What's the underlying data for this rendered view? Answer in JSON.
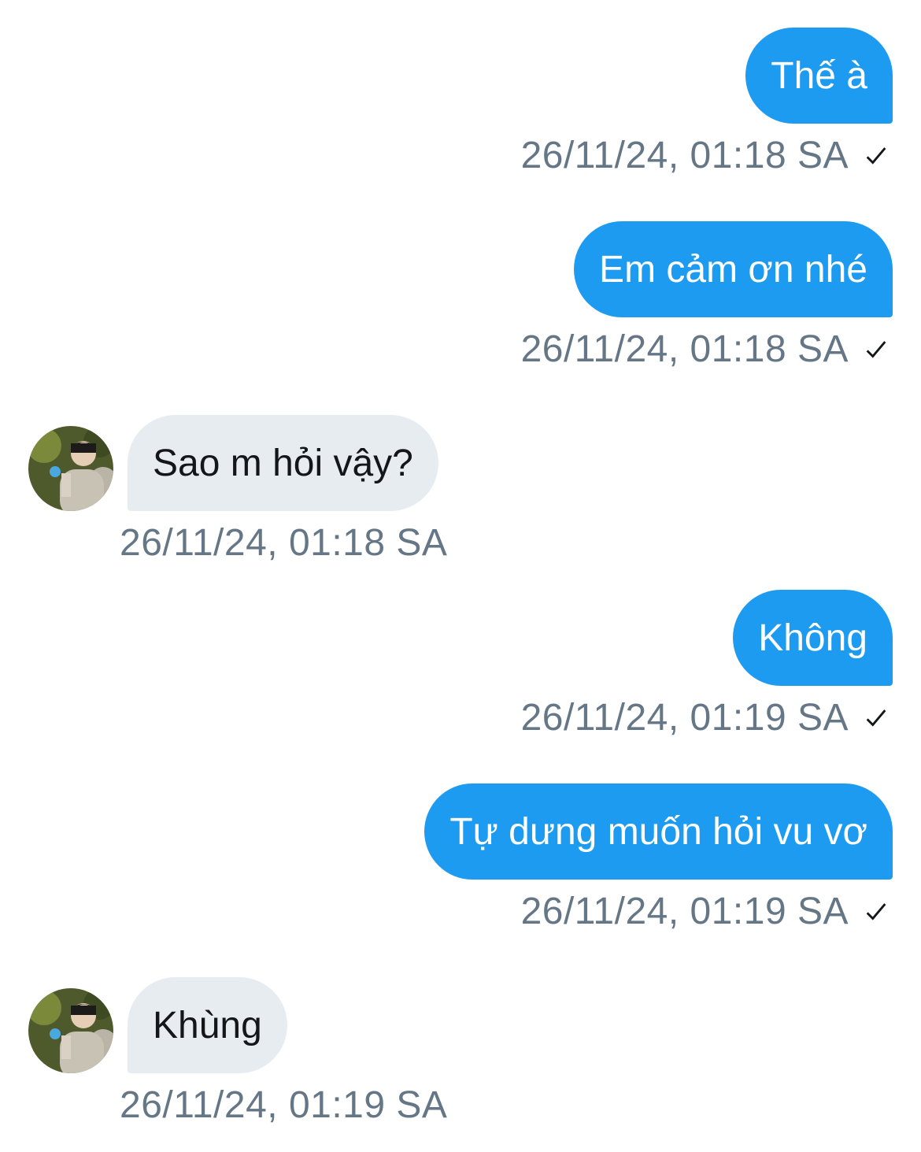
{
  "messages": [
    {
      "direction": "out",
      "text": "Thế à",
      "time": "26/11/24, 01:18 SA",
      "status_icon": "check-icon"
    },
    {
      "direction": "out",
      "text": "Em cảm ơn nhé",
      "time": "26/11/24, 01:18 SA",
      "status_icon": "check-icon"
    },
    {
      "direction": "in",
      "text": "Sao m hỏi vậy?",
      "time": "26/11/24, 01:18 SA",
      "avatar_icon": "avatar-photo"
    },
    {
      "direction": "out",
      "text": "Không",
      "time": "26/11/24, 01:19 SA",
      "status_icon": "check-icon"
    },
    {
      "direction": "out",
      "text": "Tự dưng muốn hỏi vu vơ",
      "time": "26/11/24, 01:19 SA",
      "status_icon": "check-icon"
    },
    {
      "direction": "in",
      "text": "Khùng",
      "time": "26/11/24, 01:19 SA",
      "avatar_icon": "avatar-photo"
    }
  ],
  "colors": {
    "outgoing_bubble": "#1d9bf0",
    "incoming_bubble": "#e7ecf0",
    "timestamp": "#657786",
    "background": "#ffffff"
  }
}
